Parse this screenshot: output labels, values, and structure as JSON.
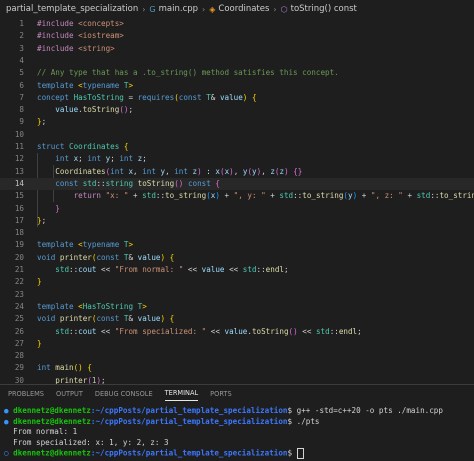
{
  "breadcrumb": {
    "folder": "partial_template_specialization",
    "file": "main.cpp",
    "class": "Coordinates",
    "method": "toString() const"
  },
  "editor": {
    "current_line": 14
  },
  "panel": {
    "tabs": [
      {
        "label": "PROBLEMS",
        "active": false
      },
      {
        "label": "OUTPUT",
        "active": false
      },
      {
        "label": "DEBUG CONSOLE",
        "active": false
      },
      {
        "label": "TERMINAL",
        "active": true
      },
      {
        "label": "PORTS",
        "active": false
      }
    ]
  },
  "terminal": {
    "user": "dkennetz@dkennetz",
    "path": ":~/cppPosts/partial_template_specialization",
    "prompt_suffix": "$",
    "commands": [
      "g++ -std=c++20 -o pts ./main.cpp",
      "./pts"
    ],
    "output": [
      "From normal: 1",
      "From specialized: x: 1, y: 2, z: 3"
    ]
  },
  "colors": {
    "keyword": "#569cd6",
    "type": "#4ec9b0",
    "function": "#dcdcaa",
    "string": "#ce9178",
    "comment": "#6a9955",
    "variable": "#9cdcfe",
    "prompt_user": "#16c60c",
    "prompt_path": "#3b78ff"
  }
}
